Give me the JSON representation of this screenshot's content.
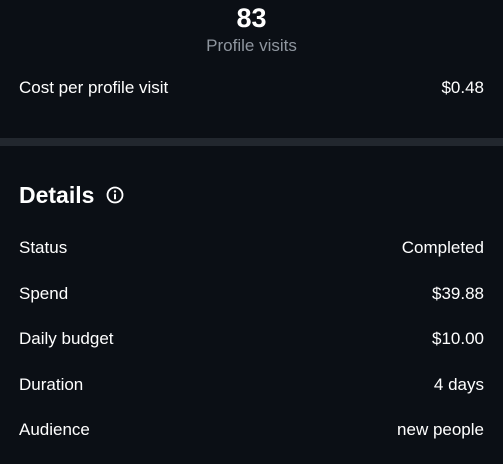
{
  "metric": {
    "value": "83",
    "label": "Profile visits"
  },
  "cost": {
    "label": "Cost per profile visit",
    "value": "$0.48"
  },
  "details": {
    "title": "Details",
    "info_icon": "info-icon",
    "rows": [
      {
        "label": "Status",
        "value": "Completed"
      },
      {
        "label": "Spend",
        "value": "$39.88"
      },
      {
        "label": "Daily budget",
        "value": "$10.00"
      },
      {
        "label": "Duration",
        "value": "4 days"
      },
      {
        "label": "Audience",
        "value": "new people"
      }
    ]
  },
  "colors": {
    "background": "#0b0f15",
    "divider": "#22272e",
    "muted_text": "#8f969f",
    "text": "#ffffff"
  }
}
